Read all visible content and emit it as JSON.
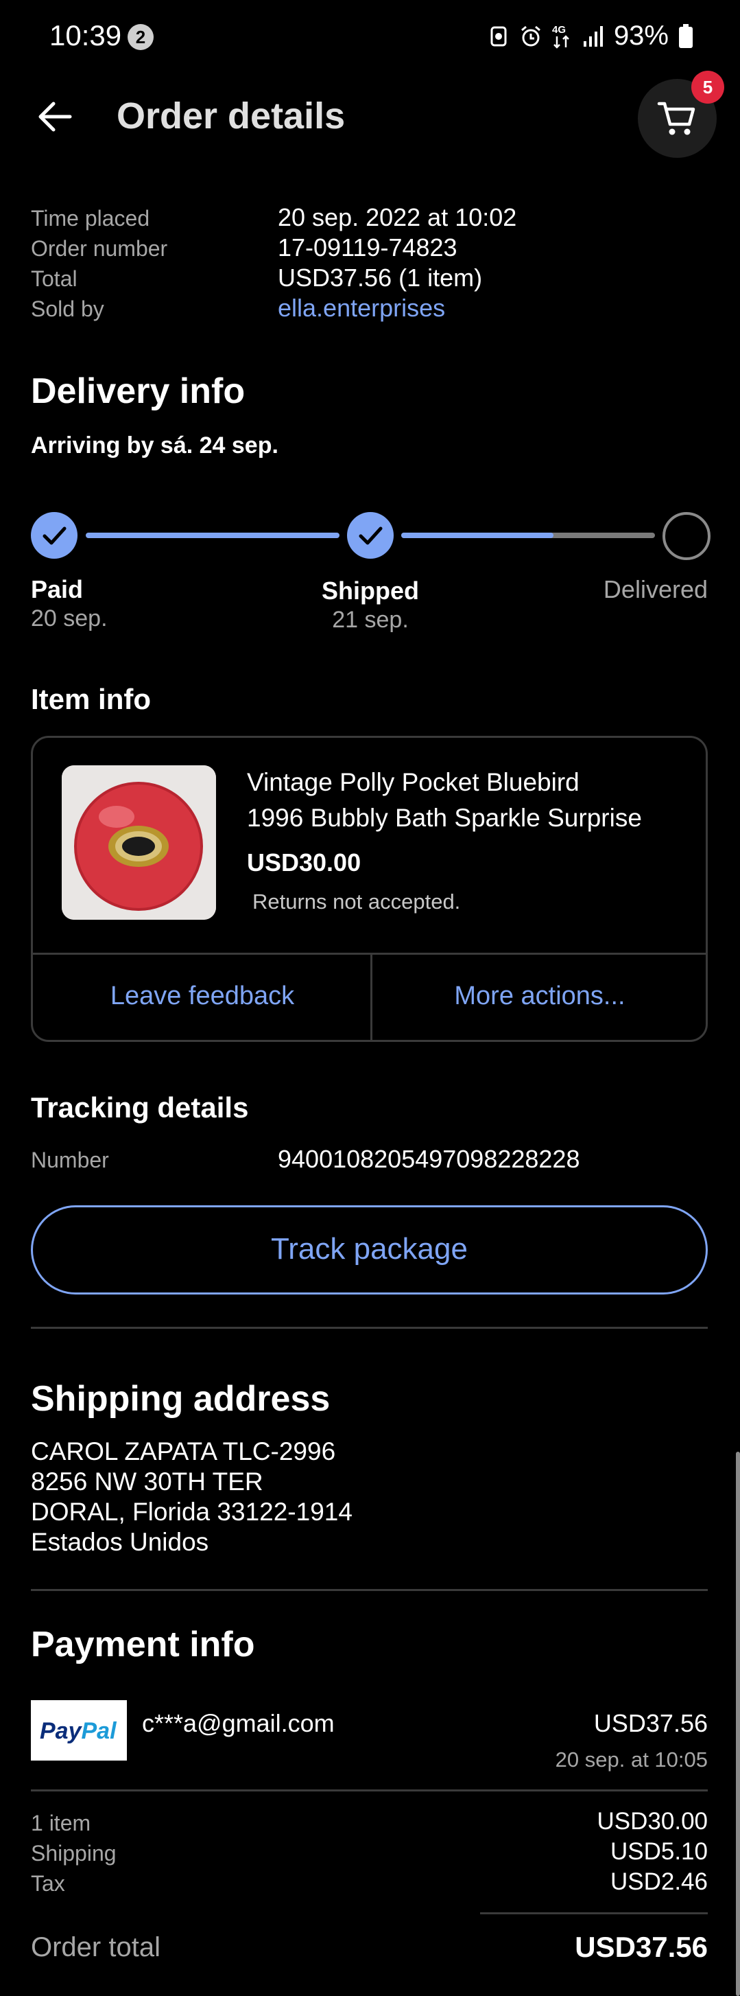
{
  "status_bar": {
    "time": "10:39",
    "notification_count": "2",
    "network": "4G",
    "battery": "93%"
  },
  "header": {
    "title": "Order details",
    "cart_count": "5"
  },
  "summary": {
    "time_placed_label": "Time placed",
    "time_placed_value": "20 sep. 2022 at 10:02",
    "order_number_label": "Order number",
    "order_number_value": "17-09119-74823",
    "total_label": "Total",
    "total_value": "USD37.56 (1 item)",
    "sold_by_label": "Sold by",
    "sold_by_value": "ella.enterprises"
  },
  "delivery": {
    "heading": "Delivery info",
    "arriving": "Arriving by sá. 24 sep.",
    "steps": [
      {
        "label": "Paid",
        "date": "20 sep.",
        "done": true
      },
      {
        "label": "Shipped",
        "date": "21 sep.",
        "done": true
      },
      {
        "label": "Delivered",
        "date": "",
        "done": false
      }
    ],
    "progress_fraction": 0.6
  },
  "item_info": {
    "heading": "Item info",
    "title_line1": "Vintage Polly Pocket Bluebird",
    "title_line2": "1996 Bubbly Bath Sparkle Surprise",
    "price": "USD30.00",
    "returns": "Returns not accepted.",
    "leave_feedback": "Leave feedback",
    "more_actions": "More actions..."
  },
  "tracking": {
    "heading": "Tracking details",
    "number_label": "Number",
    "number_value": "9400108205497098228228",
    "track_button": "Track package"
  },
  "shipping": {
    "heading": "Shipping address",
    "line1": "CAROL ZAPATA TLC-2996",
    "line2": "8256 NW 30TH TER",
    "line3": "DORAL, Florida 33122-1914",
    "line4": "Estados Unidos"
  },
  "payment": {
    "heading": "Payment info",
    "method_logo_text_1": "Pay",
    "method_logo_text_2": "Pal",
    "email": "c***a@gmail.com",
    "amount": "USD37.56",
    "paid_at": "20 sep. at 10:05",
    "items_label": "1 item",
    "items_value": "USD30.00",
    "shipping_label": "Shipping",
    "shipping_value": "USD5.10",
    "tax_label": "Tax",
    "tax_value": "USD2.46",
    "order_total_label": "Order total",
    "order_total_value": "USD37.56"
  },
  "colors": {
    "accent": "#7fa5f5",
    "badge": "#e0253c",
    "background": "#000000"
  }
}
